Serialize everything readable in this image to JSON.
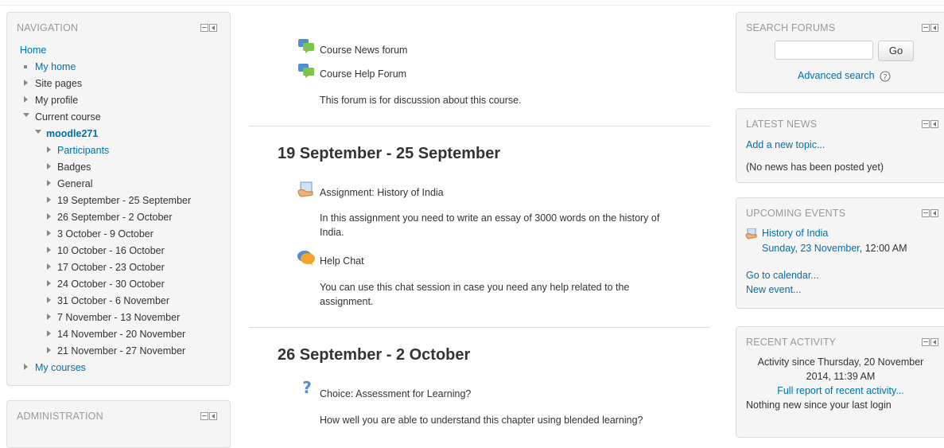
{
  "navigation": {
    "title": "NAVIGATION",
    "home": "Home",
    "items": [
      {
        "label": "My home"
      },
      {
        "label": "Site pages"
      },
      {
        "label": "My profile"
      },
      {
        "label": "Current course"
      },
      {
        "label": "moodle271"
      },
      {
        "label": "Participants"
      },
      {
        "label": "Badges"
      },
      {
        "label": "General"
      },
      {
        "label": "19 September - 25 September"
      },
      {
        "label": "26 September - 2 October"
      },
      {
        "label": "3 October - 9 October"
      },
      {
        "label": "10 October - 16 October"
      },
      {
        "label": "17 October - 23 October"
      },
      {
        "label": "24 October - 30 October"
      },
      {
        "label": "31 October - 6 November"
      },
      {
        "label": "7 November - 13 November"
      },
      {
        "label": "14 November - 20 November"
      },
      {
        "label": "21 November - 27 November"
      },
      {
        "label": "My courses"
      }
    ]
  },
  "administration": {
    "title": "ADMINISTRATION"
  },
  "main": {
    "news_forum": "Course News forum",
    "help_forum": "Course Help Forum",
    "help_forum_desc": "This forum is for discussion about this course.",
    "section1": {
      "title": "19 September - 25 September",
      "assignment": "Assignment: History of India",
      "assignment_desc_1": "In this assignment you need to write an essay of 3000 words on the history of",
      "assignment_desc_2": "India.",
      "chat": "Help Chat",
      "chat_desc_1": "You can use this chat session in case you need any help related to the",
      "chat_desc_2": "assignment."
    },
    "section2": {
      "title": "26 September - 2 October",
      "choice": "Choice: Assessment for Learning?",
      "choice_desc": "How well you are able to understand this chapter using blended learning?"
    }
  },
  "search_forums": {
    "title": "SEARCH FORUMS",
    "input_value": "",
    "go_label": "Go",
    "advanced": "Advanced search"
  },
  "latest_news": {
    "title": "LATEST NEWS",
    "add_topic": "Add a new topic...",
    "empty": "(No news has been posted yet)"
  },
  "upcoming_events": {
    "title": "UPCOMING EVENTS",
    "event_name": "History of India",
    "event_date": "Sunday, 23 November",
    "event_time": ", 12:00 AM",
    "goto_calendar": "Go to calendar...",
    "new_event": "New event..."
  },
  "recent_activity": {
    "title": "RECENT ACTIVITY",
    "since_1": "Activity since Thursday, 20 November",
    "since_2": "2014, 11:39 AM",
    "full_report": "Full report of recent activity...",
    "nothing_new": "Nothing new since your last login"
  },
  "colors": {
    "link": "#0070a8",
    "block_bg": "#f5f5f5",
    "title_gray": "#999999"
  }
}
